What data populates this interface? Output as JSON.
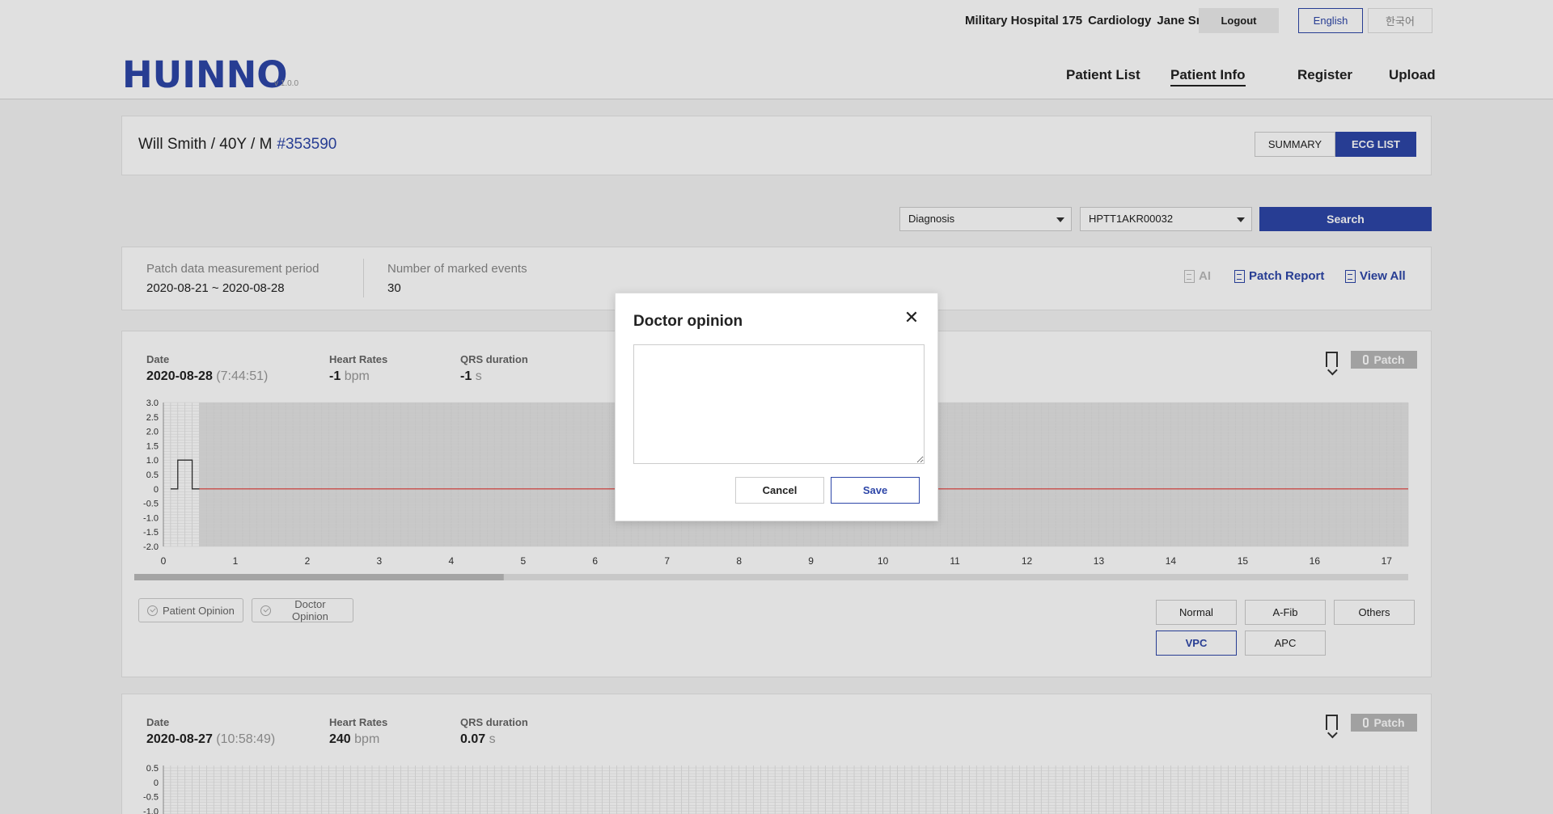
{
  "header": {
    "hospital": "Military Hospital 175",
    "department": "Cardiology",
    "user": "Jane Smith",
    "logout_label": "Logout",
    "lang_english": "English",
    "lang_korean": "한국어",
    "logo": "HUINNO",
    "version": "v 1.0.0",
    "nav": [
      "Patient List",
      "Patient Info",
      "Register",
      "Upload"
    ],
    "active_nav": "Patient Info"
  },
  "patient": {
    "summary": "Will Smith / 40Y / M",
    "id": "#353590",
    "view_summary": "SUMMARY",
    "view_ecg_list": "ECG LIST",
    "active_view": "ECG LIST"
  },
  "filters": {
    "diagnosis": "Diagnosis",
    "device": "HPTT1AKR00032",
    "search_label": "Search"
  },
  "stats": {
    "period_label": "Patch data measurement period",
    "period_value": "2020-08-21 ~ 2020-08-28",
    "events_label": "Number of marked events",
    "events_value": "30",
    "ai_label": "AI",
    "patch_report_label": "Patch Report",
    "view_all_label": "View All"
  },
  "ecg_records": [
    {
      "date_label": "Date",
      "date": "2020-08-28",
      "time": "(7:44:51)",
      "hr_label": "Heart Rates",
      "hr": "-1",
      "hr_unit": "bpm",
      "qrs_label": "QRS duration",
      "qrs": "-1",
      "qrs_unit": "s",
      "patch_label": "Patch",
      "patient_opinion_label": "Patient Opinion",
      "doctor_opinion_label": "Doctor Opinion",
      "diagnoses": [
        "Normal",
        "A-Fib",
        "Others",
        "VPC",
        "APC"
      ],
      "selected_diagnosis": "VPC"
    },
    {
      "date_label": "Date",
      "date": "2020-08-27",
      "time": "(10:58:49)",
      "hr_label": "Heart Rates",
      "hr": "240",
      "hr_unit": "bpm",
      "qrs_label": "QRS duration",
      "qrs": "0.07",
      "qrs_unit": "s",
      "patch_label": "Patch"
    }
  ],
  "chart_data": {
    "type": "line",
    "x_ticks": [
      "0",
      "1",
      "2",
      "3",
      "4",
      "5",
      "6",
      "7",
      "8",
      "9",
      "10",
      "11",
      "12",
      "13",
      "14",
      "15",
      "16",
      "17"
    ],
    "y_ticks": [
      "3.0",
      "2.5",
      "2.0",
      "1.5",
      "1.0",
      "0.5",
      "0",
      "-0.5",
      "-1.0",
      "-1.5",
      "-2.0"
    ],
    "xlim": [
      0,
      17.3
    ],
    "ylim": [
      -2.0,
      3.0
    ],
    "calibration_pulse": {
      "x": [
        0.1,
        0.2,
        0.2,
        0.4,
        0.4,
        0.5
      ],
      "y": [
        0,
        0,
        1.0,
        1.0,
        0,
        0
      ]
    },
    "signal": {
      "x": [
        0.5,
        17.3
      ],
      "y": [
        0,
        0
      ]
    },
    "signal_color": "#e53935",
    "scroll_fraction": 0.29,
    "grid": true
  },
  "modal": {
    "title": "Doctor opinion",
    "text": "",
    "cancel_label": "Cancel",
    "save_label": "Save"
  },
  "colors": {
    "accent": "#2d46a8",
    "ecg_line": "#e53935"
  }
}
